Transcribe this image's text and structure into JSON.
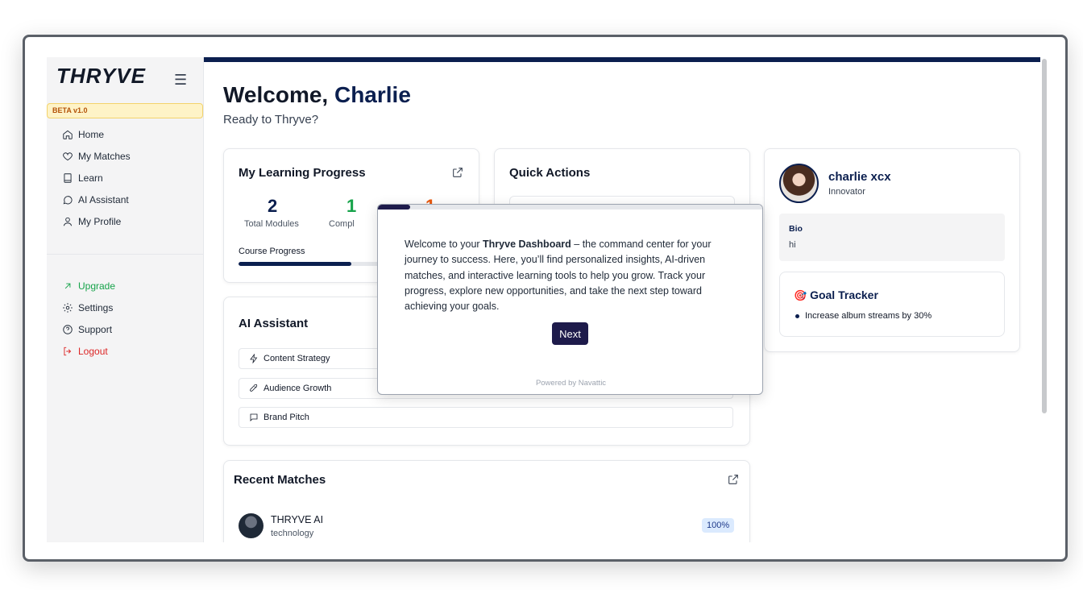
{
  "brand": {
    "logo": "THRYVE",
    "beta_badge": "BETA v1.0"
  },
  "sidebar": {
    "main_items": [
      {
        "label": "Home",
        "icon": "home-icon"
      },
      {
        "label": "My Matches",
        "icon": "heart-icon"
      },
      {
        "label": "Learn",
        "icon": "book-icon"
      },
      {
        "label": "AI Assistant",
        "icon": "chat-icon"
      },
      {
        "label": "My Profile",
        "icon": "user-icon"
      }
    ],
    "secondary_items": [
      {
        "label": "Upgrade",
        "icon": "arrow-up-right-icon",
        "color": "#16a34a"
      },
      {
        "label": "Settings",
        "icon": "gear-icon"
      },
      {
        "label": "Support",
        "icon": "help-circle-icon"
      },
      {
        "label": "Logout",
        "icon": "logout-icon",
        "color": "#dc2626"
      }
    ]
  },
  "header": {
    "greeting": "Welcome,",
    "name": "Charlie",
    "subtitle": "Ready to Thryve?"
  },
  "learning": {
    "title": "My Learning Progress",
    "total_modules": "2",
    "total_label": "Total Modules",
    "completed": "1",
    "completed_label_visible": "Compl",
    "third_value_visible": "1",
    "course_progress_label": "Course Progress",
    "course_progress_fraction": 0.5
  },
  "quick_actions": {
    "title": "Quick Actions"
  },
  "ai_assistant": {
    "title": "AI Assistant",
    "actions": [
      {
        "label": "Content Strategy",
        "icon": "zap-icon"
      },
      {
        "label": "Audience Growth",
        "icon": "rocket-icon"
      },
      {
        "label": "Brand Pitch",
        "icon": "message-square-icon"
      }
    ]
  },
  "recent_matches": {
    "title": "Recent Matches",
    "items": [
      {
        "name": "THRYVE AI",
        "category": "technology",
        "score": "100%"
      }
    ]
  },
  "profile": {
    "name": "charlie xcx",
    "role": "Innovator",
    "bio_label": "Bio",
    "bio": "hi",
    "goal_title": "Goal Tracker",
    "goal_emoji": "🎯",
    "goals": [
      "Increase album streams by 30%"
    ]
  },
  "popup": {
    "text_prefix": "Welcome to your ",
    "text_bold": "Thryve Dashboard",
    "text_suffix": " – the command center for your journey to success. Here, you’ll find personalized insights, AI-driven matches, and interactive learning tools to help you grow. Track your progress, explore new opportunities, and take the next step toward achieving your goals.",
    "next_label": "Next",
    "powered_by": "Powered by Navattic"
  },
  "colors": {
    "navy": "#0b1f4f",
    "green": "#16a34a",
    "red": "#dc2626",
    "orange": "#ea580c",
    "popup_dark": "#1e1b4b"
  }
}
